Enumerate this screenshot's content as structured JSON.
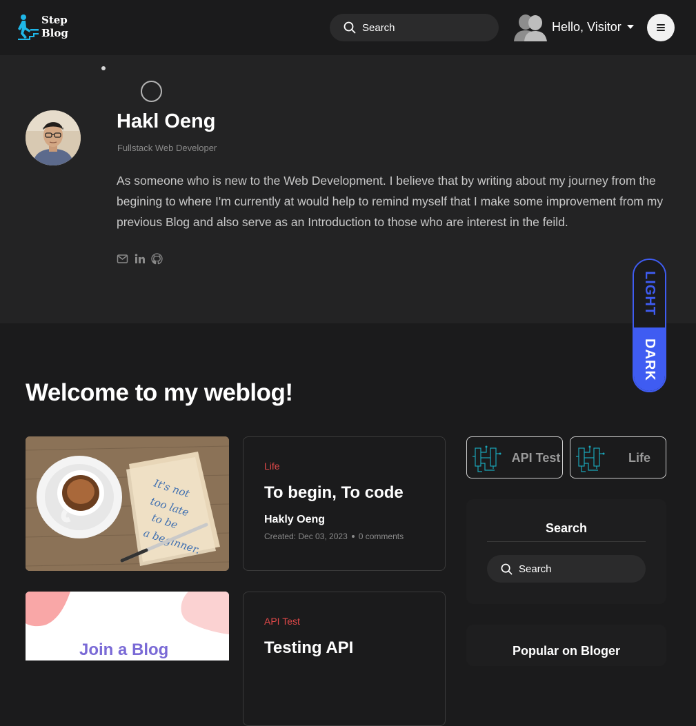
{
  "navbar": {
    "logo_line1": "Step",
    "logo_line2": "Blog",
    "search_placeholder": "Search",
    "greeting": "Hello, Visitor",
    "menu_icon": "hamburger-icon"
  },
  "hero": {
    "name": "Hakl Oeng",
    "role": "Fullstack Web Developer",
    "bio": "As someone who is new to the Web Development. I believe that by writing about my journey from the begining to where I'm currently at would help to remind myself that I make some improvement from my previous Blog and also serve as an Introduction to those who are interest in the feild.",
    "socials": [
      "email-icon",
      "linkedin-icon",
      "github-icon"
    ]
  },
  "theme": {
    "light_label": "LIGHT",
    "dark_label": "DARK",
    "active": "dark",
    "accent": "#3f5cf2"
  },
  "main": {
    "heading": "Welcome to my weblog!",
    "posts": [
      {
        "category": "Life",
        "title": "To begin, To code",
        "author": "Hakly Oeng",
        "created": "Created: Dec 03, 2023",
        "comments": "0 comments",
        "image_text": "It's not too late to be a beginner."
      },
      {
        "category": "API Test",
        "title": "Testing API",
        "image_text": "Join a Blog"
      }
    ]
  },
  "sidebar": {
    "categories": [
      {
        "label": "API Test"
      },
      {
        "label": "Life"
      }
    ],
    "search_title": "Search",
    "search_placeholder": "Search",
    "popular_title": "Popular on Bloger"
  },
  "colors": {
    "background": "#1b1b1c",
    "hero_bg": "#232324",
    "category": "#e04949",
    "logo_accent": "#1fb7e8"
  }
}
